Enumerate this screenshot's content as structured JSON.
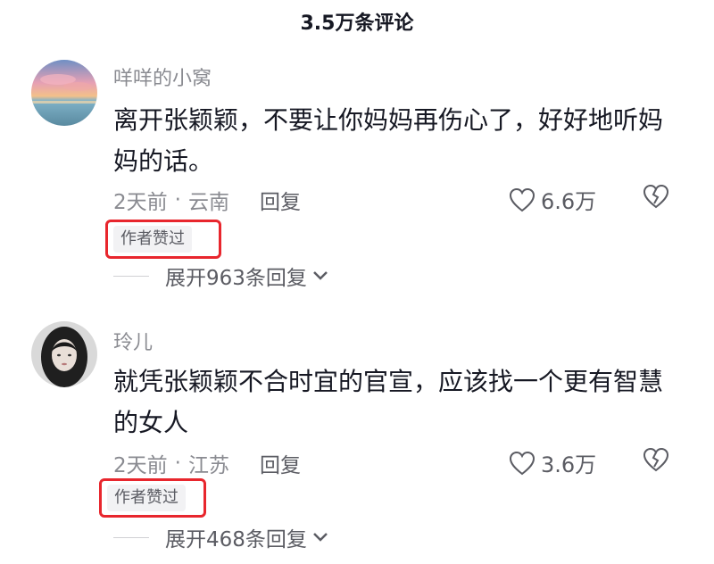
{
  "header": {
    "title": "3.5万条评论"
  },
  "comments": [
    {
      "author": "咩咩的小窝",
      "text": "离开张颖颖，不要让你妈妈再伤心了，好好地听妈妈的话。",
      "time": "2天前",
      "location": "云南",
      "reply_label": "回复",
      "likes": "6.6万",
      "badge": "作者赞过",
      "expand": "展开963条回复"
    },
    {
      "author": "玲儿",
      "text": "就凭张颖颖不合时宜的官宣，应该找一个更有智慧的女人",
      "time": "2天前",
      "location": "江苏",
      "reply_label": "回复",
      "likes": "3.6万",
      "badge": "作者赞过",
      "expand": "展开468条回复"
    }
  ],
  "colors": {
    "highlight": "#e8262d",
    "text": "#161823",
    "muted": "#8a8b91"
  }
}
